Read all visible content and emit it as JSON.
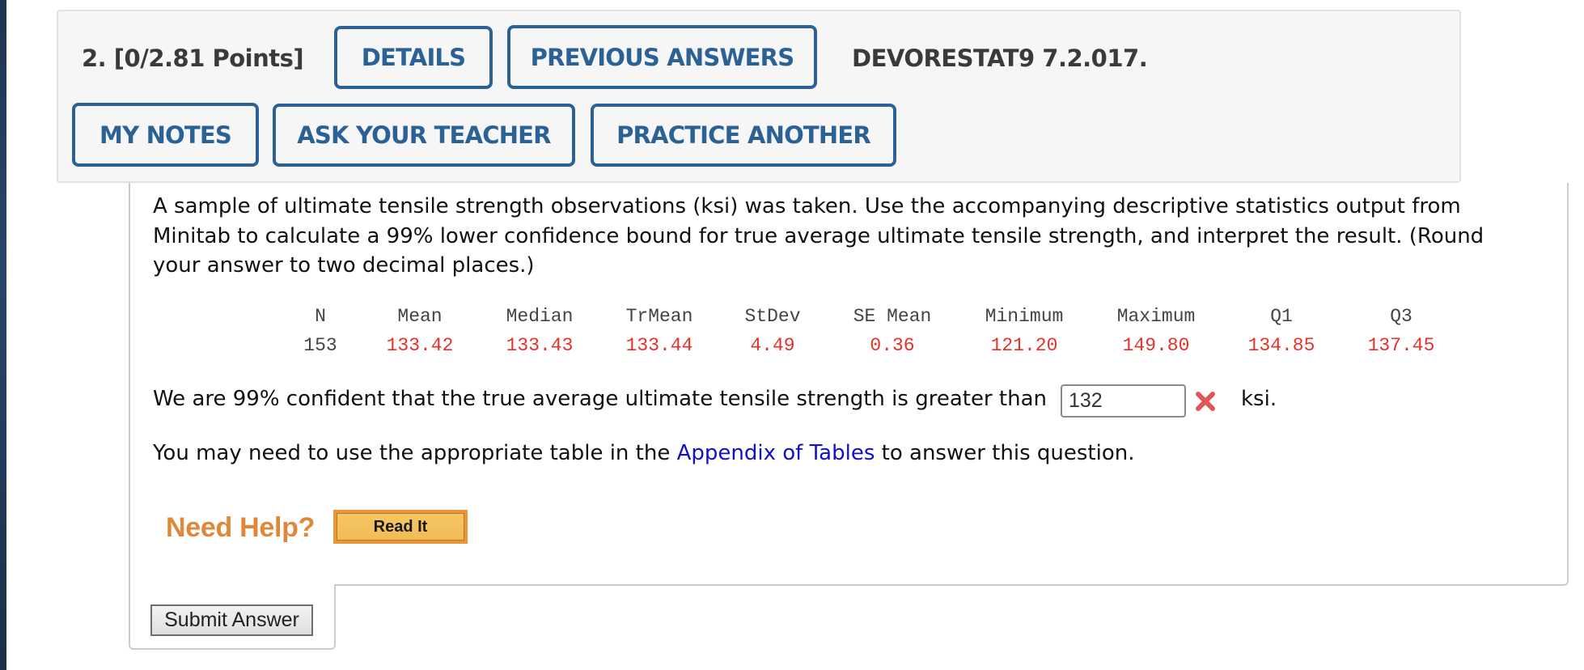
{
  "question": {
    "number_points": "2.  [0/2.81 Points]",
    "title": "DEVORESTAT9 7.2.017."
  },
  "toolbar": {
    "details": "DETAILS",
    "previous_answers": "PREVIOUS ANSWERS",
    "my_notes": "MY NOTES",
    "ask_teacher": "ASK YOUR TEACHER",
    "practice_another": "PRACTICE ANOTHER"
  },
  "body": {
    "prompt": "A sample of ultimate tensile strength observations (ksi) was taken. Use the accompanying descriptive statistics output from Minitab to calculate a 99% lower confidence bound for true average ultimate tensile strength, and interpret the result. (Round your answer to two decimal places.)",
    "stats": {
      "headers": [
        "N",
        "Mean",
        "Median",
        "TrMean",
        "StDev",
        "SE Mean",
        "Minimum",
        "Maximum",
        "Q1",
        "Q3"
      ],
      "values": [
        "153",
        "133.42",
        "133.43",
        "133.44",
        "4.49",
        "0.36",
        "121.20",
        "149.80",
        "134.85",
        "137.45"
      ]
    },
    "answer_prefix": "We are 99% confident that the true average ultimate tensile strength is greater than",
    "answer_value": "132",
    "answer_status": "incorrect",
    "answer_unit": "ksi.",
    "appendix_before": "You may need to use the appropriate table in the ",
    "appendix_link": "Appendix of Tables",
    "appendix_after": " to answer this question."
  },
  "help": {
    "label": "Need Help?",
    "read_it": "Read It"
  },
  "submit_label": "Submit Answer",
  "colors": {
    "button_border": "#2c6196",
    "stat_value": "#e8302a",
    "help_orange": "#e0883a",
    "link": "#1010c8",
    "wrong_mark": "#e05555"
  }
}
